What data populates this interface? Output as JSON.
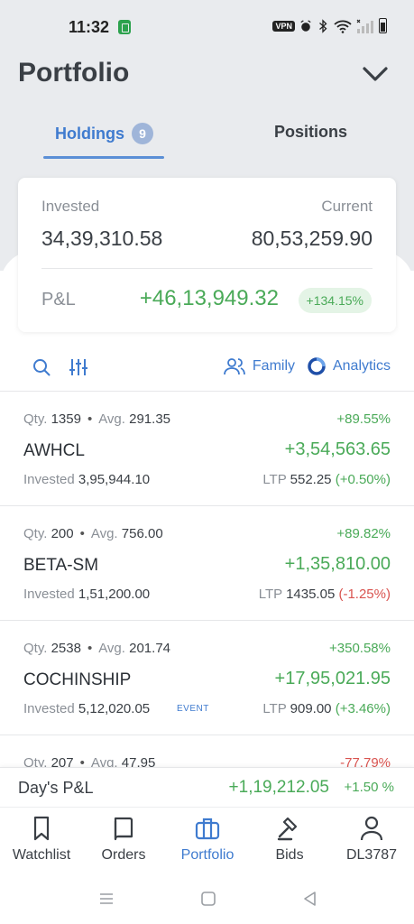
{
  "status": {
    "time": "11:32",
    "vpn": "VPN"
  },
  "header": {
    "title": "Portfolio"
  },
  "tabs": {
    "holdings_label": "Holdings",
    "holdings_count": "9",
    "positions_label": "Positions"
  },
  "summary": {
    "invested_label": "Invested",
    "invested_value": "34,39,310.58",
    "current_label": "Current",
    "current_value": "80,53,259.90",
    "pnl_label": "P&L",
    "pnl_value": "+46,13,949.32",
    "pnl_pct": "+134.15%"
  },
  "toolbar": {
    "family_label": "Family",
    "analytics_label": "Analytics"
  },
  "holdings": [
    {
      "qty_label": "Qty.",
      "qty": "1359",
      "avg_label": "Avg.",
      "avg": "291.35",
      "pct": "+89.55%",
      "symbol": "AWHCL",
      "pnl": "+3,54,563.65",
      "invested_label": "Invested",
      "invested": "3,95,944.10",
      "ltp_label": "LTP",
      "ltp": "552.25",
      "ltp_change": "(+0.50%)",
      "event": ""
    },
    {
      "qty_label": "Qty.",
      "qty": "200",
      "avg_label": "Avg.",
      "avg": "756.00",
      "pct": "+89.82%",
      "symbol": "BETA-SM",
      "pnl": "+1,35,810.00",
      "invested_label": "Invested",
      "invested": "1,51,200.00",
      "ltp_label": "LTP",
      "ltp": "1435.05",
      "ltp_change": "(-1.25%)",
      "event": ""
    },
    {
      "qty_label": "Qty.",
      "qty": "2538",
      "avg_label": "Avg.",
      "avg": "201.74",
      "pct": "+350.58%",
      "symbol": "COCHINSHIP",
      "pnl": "+17,95,021.95",
      "invested_label": "Invested",
      "invested": "5,12,020.05",
      "ltp_label": "LTP",
      "ltp": "909.00",
      "ltp_change": "(+3.46%)",
      "event": "EVENT"
    },
    {
      "qty_label": "Qty.",
      "qty": "207",
      "avg_label": "Avg.",
      "avg": "47.95",
      "pct": "-77.79%"
    }
  ],
  "day_pnl": {
    "label": "Day's P&L",
    "value": "+1,19,212.05",
    "pct": "+1.50 %"
  },
  "nav": {
    "watchlist": "Watchlist",
    "orders": "Orders",
    "portfolio": "Portfolio",
    "bids": "Bids",
    "account": "DL3787"
  },
  "colors": {
    "accent": "#3f7bcf",
    "positive": "#4aaa58",
    "negative": "#d9534f",
    "header_bg": "#e9ebee"
  }
}
